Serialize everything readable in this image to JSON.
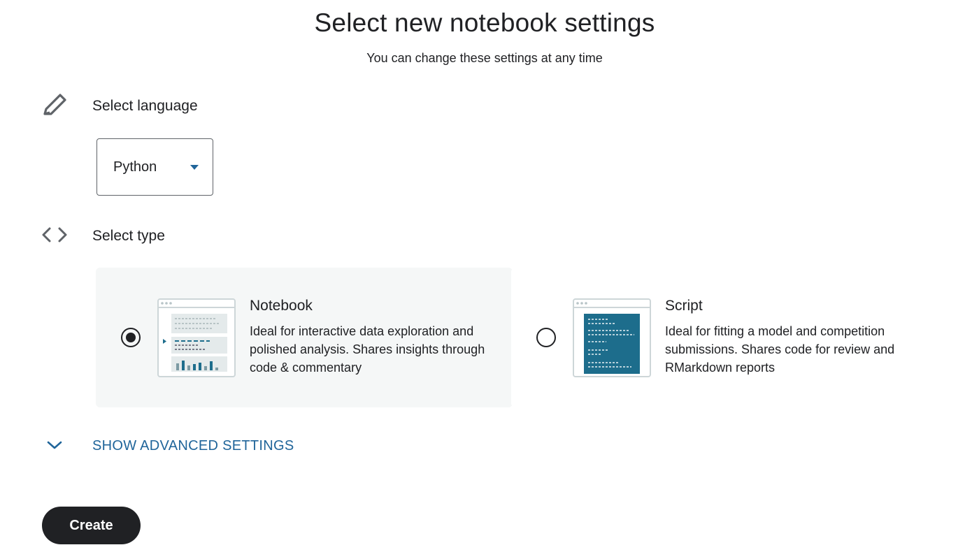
{
  "header": {
    "title": "Select new notebook settings",
    "subtitle": "You can change these settings at any time"
  },
  "language": {
    "label": "Select language",
    "icon": "pencil-icon",
    "selected": "Python"
  },
  "type": {
    "label": "Select type",
    "icon": "code-brackets-icon",
    "options": [
      {
        "title": "Notebook",
        "description": "Ideal for interactive data exploration and polished analysis. Shares insights through code & commentary",
        "selected": true
      },
      {
        "title": "Script",
        "description": "Ideal for fitting a model and competition submissions. Shares code for review and RMarkdown reports",
        "selected": false
      }
    ]
  },
  "advanced": {
    "label": "SHOW ADVANCED SETTINGS",
    "icon": "chevron-down-icon"
  },
  "actions": {
    "create_label": "Create"
  },
  "colors": {
    "accent": "#20659a",
    "text": "#202124",
    "selected_card_bg": "#f5f7f7",
    "script_thumb_bg": "#1d6d8c"
  }
}
